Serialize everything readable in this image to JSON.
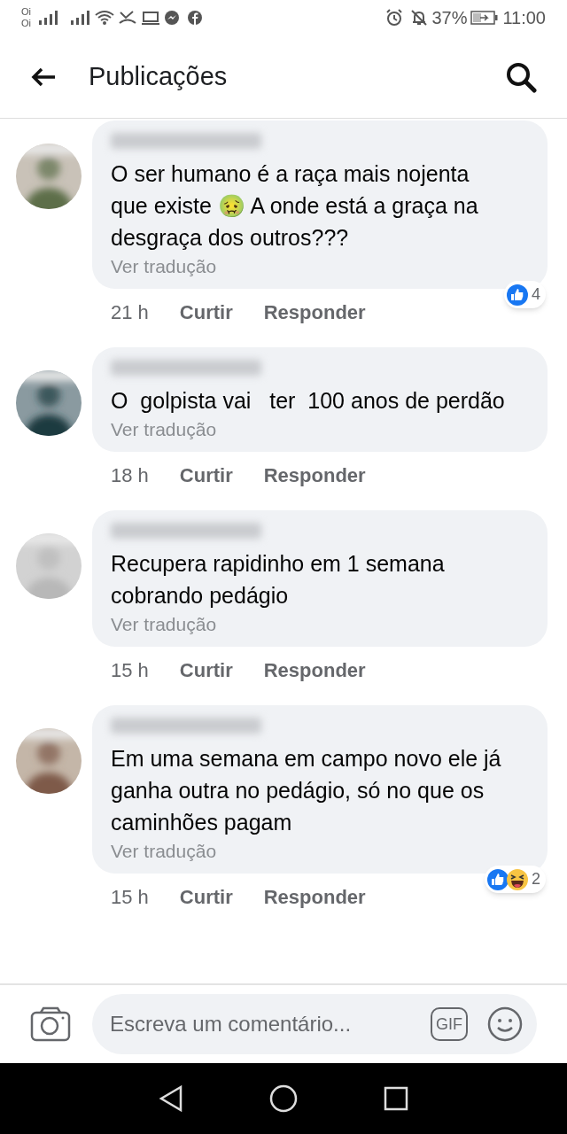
{
  "status_bar": {
    "carriers": [
      "Oi",
      "Oi"
    ],
    "battery": "37%",
    "time": "11:00"
  },
  "header": {
    "title": "Publicações"
  },
  "comments": [
    {
      "text": "O ser humano é a raça mais nojenta que existe 🤢 A onde está a graça na desgraça dos outros???",
      "translate": "Ver tradução",
      "time": "21 h",
      "like": "Curtir",
      "reply": "Responder",
      "reactions": [
        {
          "kind": "like"
        }
      ],
      "reaction_count": "4"
    },
    {
      "text": "O  golpista vai   ter  100 anos de perdão",
      "translate": "Ver tradução",
      "time": "18 h",
      "like": "Curtir",
      "reply": "Responder"
    },
    {
      "text": "Recupera rapidinho em 1 semana cobrando pedágio",
      "translate": "Ver tradução",
      "time": "15 h",
      "like": "Curtir",
      "reply": "Responder"
    },
    {
      "text": "Em uma semana em campo novo ele já ganha outra no pedágio, só no que os caminhões pagam",
      "translate": "Ver tradução",
      "time": "15 h",
      "like": "Curtir",
      "reply": "Responder",
      "reactions": [
        {
          "kind": "like"
        },
        {
          "kind": "haha"
        }
      ],
      "reaction_count": "2"
    }
  ],
  "composer": {
    "placeholder": "Escreva um comentário...",
    "gif_label": "GIF"
  }
}
